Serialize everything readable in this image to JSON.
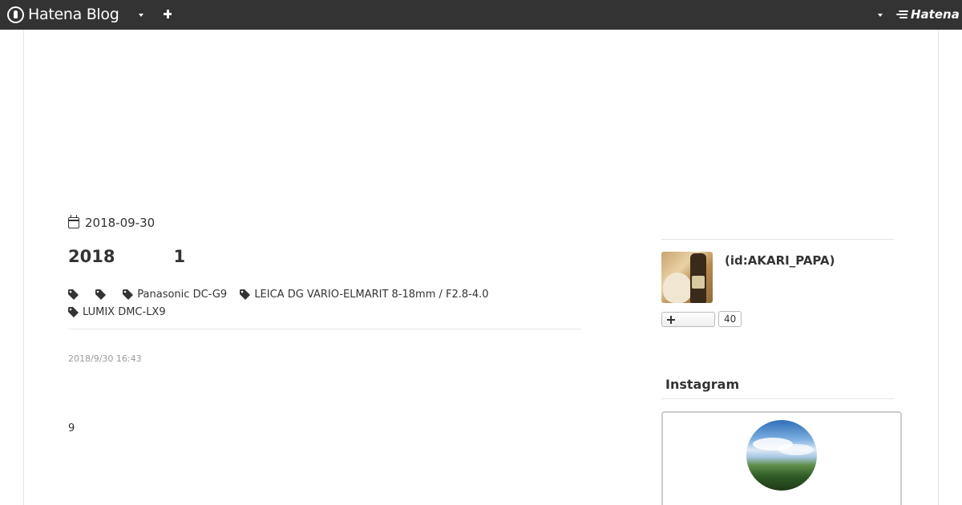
{
  "topbar": {
    "logo_text": "Hatena Blog",
    "account_menu_icon": "caret-down-icon",
    "new_post_icon": "plus-icon",
    "user_menu_icon": "caret-down-icon",
    "hatena_label": "Hatena"
  },
  "entry": {
    "date": "2018-09-30",
    "title": "2018          1",
    "tags": [
      "",
      "",
      "Panasonic DC-G9",
      "LEICA DG VARIO-ELMARIT 8-18mm / F2.8-4.0",
      "LUMIX DMC-LX9"
    ],
    "posted_time": "2018/9/30 16:43",
    "body_text": "9"
  },
  "sidebar": {
    "profile": {
      "name": "(id:AKARI_PAPA)",
      "subscribe_icon": "plus-icon",
      "subscriber_count": "40"
    },
    "instagram": {
      "title": "Instagram"
    }
  },
  "colors": {
    "topbar_bg": "#333333",
    "text": "#333333",
    "muted": "#999999",
    "border": "#e5e5e5"
  }
}
